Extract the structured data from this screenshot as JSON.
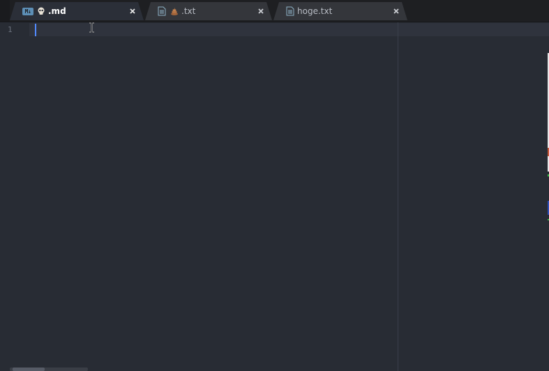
{
  "tabs": [
    {
      "label": ".md",
      "icon": "markdown-icon",
      "emoji_icon": "skull-icon",
      "badge_text": "M↓",
      "active": true
    },
    {
      "label": ".txt",
      "icon": "file-text-icon",
      "emoji_icon": "pile-of-poo-icon",
      "active": false
    },
    {
      "label": "hoge.txt",
      "icon": "file-text-icon",
      "active": false
    }
  ],
  "close_glyph": "×",
  "editor": {
    "line_numbers": [
      "1"
    ],
    "content": "",
    "colors": {
      "background": "#282c34",
      "cursor": "#528bff",
      "gutter_text": "#6b717d"
    }
  }
}
